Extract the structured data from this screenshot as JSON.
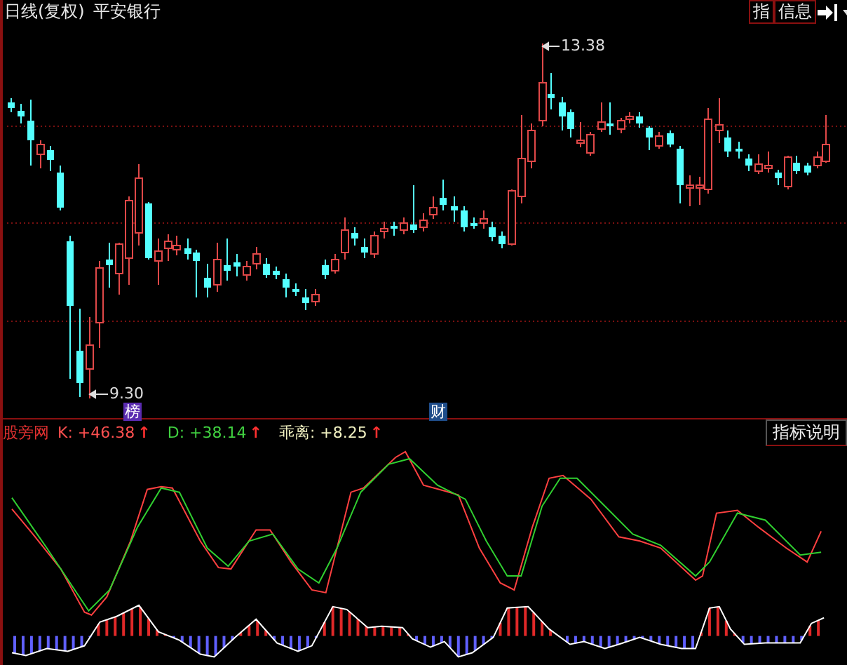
{
  "toolbar": {
    "period": "日线(复权)",
    "stock_name": "平安银行",
    "buttons": [
      {
        "label": "指"
      },
      {
        "label": "信息"
      }
    ]
  },
  "price_chart": {
    "high_label": "13.38",
    "low_label": "9.30",
    "event_badges": [
      {
        "label": "榜",
        "color": "#5a2bb0"
      },
      {
        "label": "财",
        "color": "#1f4d8a"
      }
    ]
  },
  "indicator": {
    "name": "股旁网",
    "values": [
      {
        "label": "K: +46.38",
        "arrow": "↑",
        "color": "#ff5050"
      },
      {
        "label": "D: +38.14",
        "arrow": "↑",
        "color": "#40d040"
      },
      {
        "label": "乖离: +8.25",
        "arrow": "↑",
        "color": "#f0f0c0"
      }
    ],
    "help_button": "指标说明"
  }
}
